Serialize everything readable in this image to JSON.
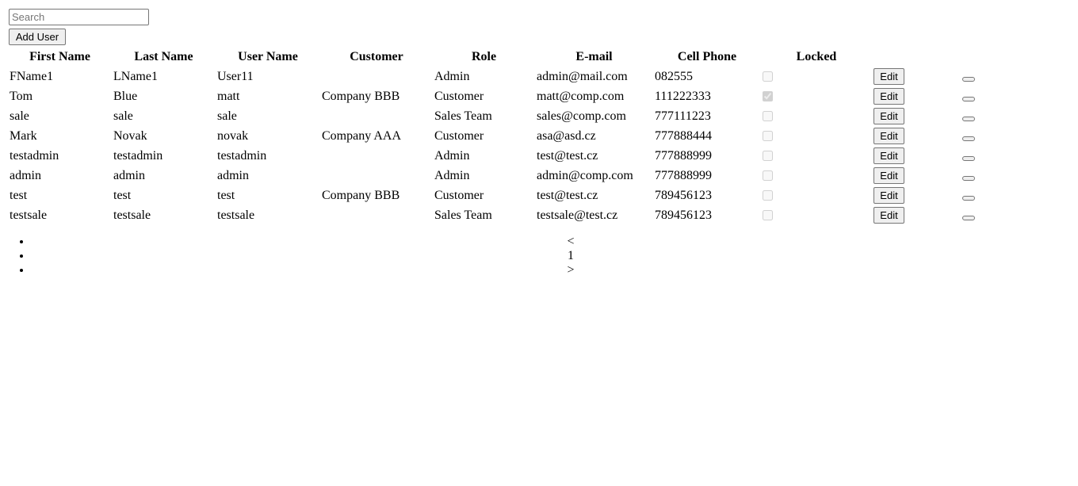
{
  "search": {
    "placeholder": "Search",
    "value": ""
  },
  "toolbar": {
    "add_user_label": "Add User"
  },
  "table": {
    "headers": {
      "first_name": "First Name",
      "last_name": "Last Name",
      "user_name": "User Name",
      "customer": "Customer",
      "role": "Role",
      "email": "E-mail",
      "cell_phone": "Cell Phone",
      "locked": "Locked"
    },
    "edit_label": "Edit",
    "rows": [
      {
        "first_name": "FName1",
        "last_name": "LName1",
        "user_name": "User11",
        "customer": "",
        "role": "Admin",
        "email": "admin@mail.com",
        "cell_phone": "082555",
        "locked": false
      },
      {
        "first_name": "Tom",
        "last_name": "Blue",
        "user_name": "matt",
        "customer": "Company BBB",
        "role": "Customer",
        "email": "matt@comp.com",
        "cell_phone": "111222333",
        "locked": true
      },
      {
        "first_name": "sale",
        "last_name": "sale",
        "user_name": "sale",
        "customer": "",
        "role": "Sales Team",
        "email": "sales@comp.com",
        "cell_phone": "777111223",
        "locked": false
      },
      {
        "first_name": "Mark",
        "last_name": "Novak",
        "user_name": "novak",
        "customer": "Company AAA",
        "role": "Customer",
        "email": "asa@asd.cz",
        "cell_phone": "777888444",
        "locked": false
      },
      {
        "first_name": "testadmin",
        "last_name": "testadmin",
        "user_name": "testadmin",
        "customer": "",
        "role": "Admin",
        "email": "test@test.cz",
        "cell_phone": "777888999",
        "locked": false
      },
      {
        "first_name": "admin",
        "last_name": "admin",
        "user_name": "admin",
        "customer": "",
        "role": "Admin",
        "email": "admin@comp.com",
        "cell_phone": "777888999",
        "locked": false
      },
      {
        "first_name": "test",
        "last_name": "test",
        "user_name": "test",
        "customer": "Company BBB",
        "role": "Customer",
        "email": "test@test.cz",
        "cell_phone": "789456123",
        "locked": false
      },
      {
        "first_name": "testsale",
        "last_name": "testsale",
        "user_name": "testsale",
        "customer": "",
        "role": "Sales Team",
        "email": "testsale@test.cz",
        "cell_phone": "789456123",
        "locked": false
      }
    ]
  },
  "pagination": {
    "prev": "<",
    "current_page": "1",
    "next": ">"
  }
}
